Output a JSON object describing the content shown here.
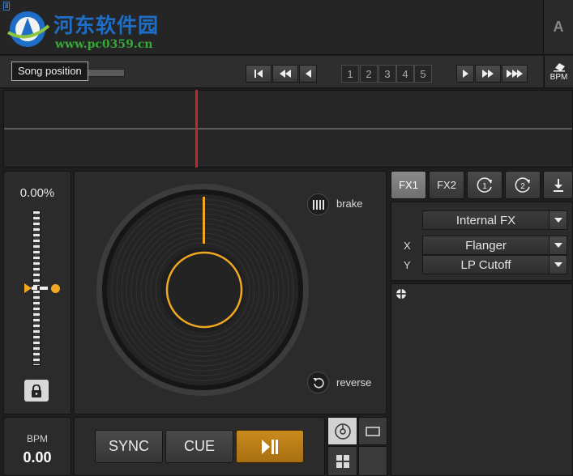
{
  "watermark": {
    "brand": "河东软件园",
    "url": "www.pc0359.cn",
    "corner": "8"
  },
  "deck": {
    "letter": "A"
  },
  "topbar": {
    "tooltip": "Song position",
    "pages": [
      "1",
      "2",
      "3",
      "4",
      "5"
    ],
    "bpm_edit_label": "BPM"
  },
  "pitch": {
    "value": "0.00%"
  },
  "turntable": {
    "brake_label": "brake",
    "reverse_label": "reverse"
  },
  "bpm": {
    "label": "BPM",
    "value": "0.00"
  },
  "transport": {
    "sync_label": "SYNC",
    "cue_label": "CUE"
  },
  "fx": {
    "tab1": "FX1",
    "tab2": "FX2",
    "rack": "Internal FX",
    "x_label": "X",
    "x_effect": "Flanger",
    "y_label": "Y",
    "y_effect": "LP Cutoff"
  },
  "colors": {
    "accent": "#f0a820",
    "playhead": "#c0282a",
    "watermark_blue": "#1e6ec8"
  }
}
